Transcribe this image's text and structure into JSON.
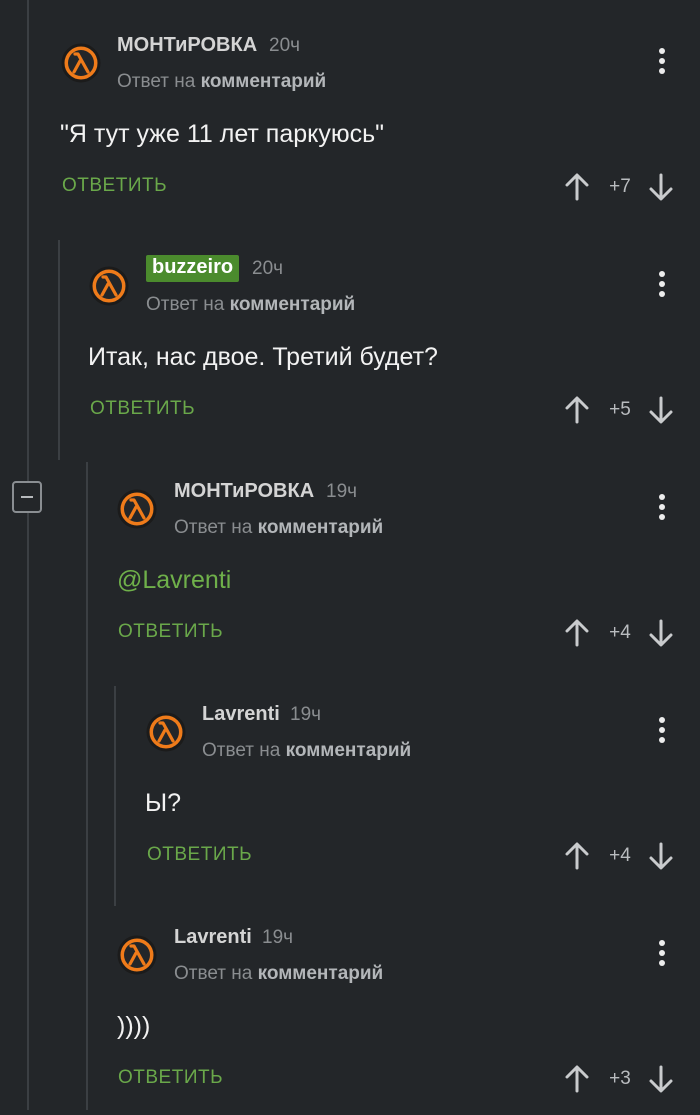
{
  "colors": {
    "background": "#232629",
    "thread_line": "#3b3f43",
    "reply_green": "#6aa84a",
    "badge_green": "#4b8b2d",
    "avatar_orange": "#ef7b1a",
    "muted_text": "#8a8d90"
  },
  "comments": [
    {
      "author": "МОНТиРОВКА",
      "time": "20ч",
      "reply_prefix": "Ответ на",
      "reply_target": "комментарий",
      "text": "\"Я тут уже 11 лет паркуюсь\"",
      "reply_label": "ОТВЕТИТЬ",
      "score": "+7",
      "avatar_icon": "lambda-avatar-icon",
      "menu_icon": "more-vertical-icon"
    },
    {
      "author": "buzzeiro",
      "time": "20ч",
      "reply_prefix": "Ответ на",
      "reply_target": "комментарий",
      "text": "Итак, нас двое. Третий будет?",
      "reply_label": "ОТВЕТИТЬ",
      "score": "+5",
      "avatar_icon": "lambda-avatar-icon",
      "menu_icon": "more-vertical-icon"
    },
    {
      "author": "МОНТиРОВКА",
      "time": "19ч",
      "reply_prefix": "Ответ на",
      "reply_target": "комментарий",
      "text": "@Lavrenti",
      "reply_label": "ОТВЕТИТЬ",
      "score": "+4",
      "avatar_icon": "lambda-avatar-icon",
      "menu_icon": "more-vertical-icon"
    },
    {
      "author": "Lavrenti",
      "time": "19ч",
      "reply_prefix": "Ответ на",
      "reply_target": "комментарий",
      "text": "Ы?",
      "reply_label": "ОТВЕТИТЬ",
      "score": "+4",
      "avatar_icon": "lambda-avatar-icon",
      "menu_icon": "more-vertical-icon"
    },
    {
      "author": "Lavrenti",
      "time": "19ч",
      "reply_prefix": "Ответ на",
      "reply_target": "комментарий",
      "text": "))))",
      "reply_label": "ОТВЕТИТЬ",
      "score": "+3",
      "avatar_icon": "lambda-avatar-icon",
      "menu_icon": "more-vertical-icon"
    }
  ]
}
